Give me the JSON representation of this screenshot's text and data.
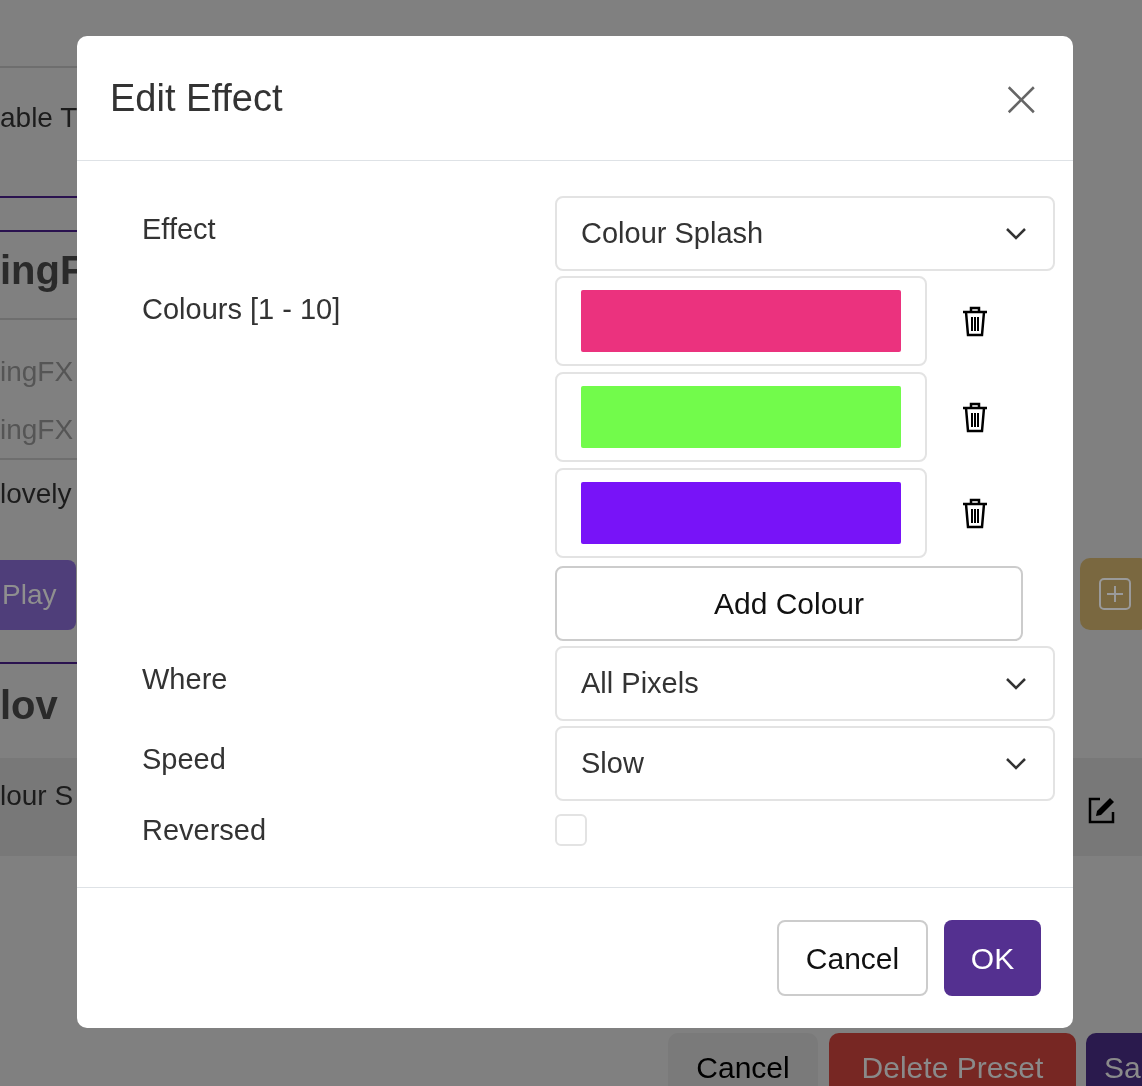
{
  "background": {
    "texts": [
      {
        "kind": "plain",
        "text": "able T"
      },
      {
        "kind": "heading",
        "text": "ingF"
      },
      {
        "kind": "muted",
        "text": "ingFX"
      },
      {
        "kind": "muted",
        "text": "ingFX"
      },
      {
        "kind": "plain",
        "text": "lovely"
      },
      {
        "kind": "button",
        "text": "Play"
      },
      {
        "kind": "heading",
        "text": "lov"
      },
      {
        "kind": "plain",
        "text": "lour S"
      }
    ],
    "bottom_buttons": [
      {
        "kind": "plain",
        "label": "Cancel"
      },
      {
        "kind": "danger",
        "label": "Delete Preset"
      },
      {
        "kind": "primary",
        "label": "Sa"
      }
    ]
  },
  "dialog": {
    "title": "Edit Effect",
    "close": "×",
    "effect": {
      "label": "Effect",
      "value": "Colour Splash"
    },
    "colours": {
      "label": "Colours [1 - 10]",
      "items": [
        {
          "color": "#eb327e"
        },
        {
          "color": "#72fb4b"
        },
        {
          "color": "#7813f8"
        }
      ],
      "add_label": "Add Colour"
    },
    "where": {
      "label": "Where",
      "value": "All Pixels"
    },
    "speed": {
      "label": "Speed",
      "value": "Slow"
    },
    "reversed": {
      "label": "Reversed",
      "checked": false
    },
    "buttons": [
      {
        "kind": "secondary",
        "label": "Cancel"
      },
      {
        "kind": "primary",
        "label": "OK"
      }
    ]
  }
}
